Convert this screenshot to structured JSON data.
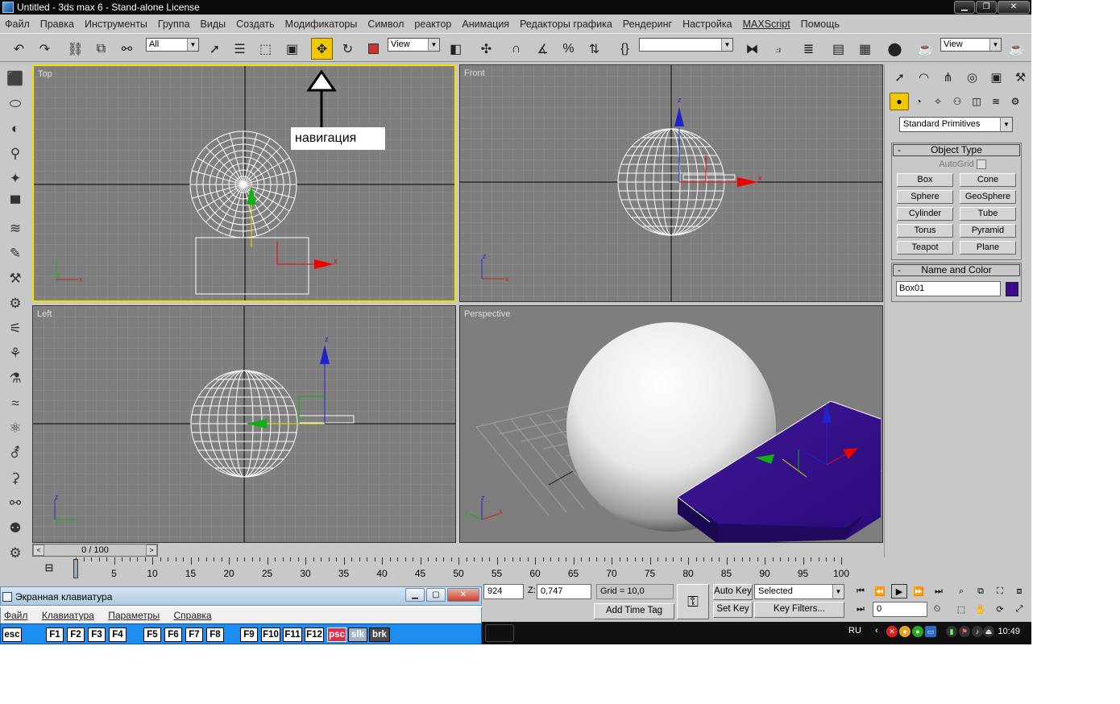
{
  "window": {
    "title": "Untitled - 3ds max 6 - Stand-alone License"
  },
  "menubar": [
    "Файл",
    "Правка",
    "Инструменты",
    "Группа",
    "Виды",
    "Создать",
    "Модификаторы",
    "Символ",
    "реактор",
    "Анимация",
    "Редакторы графика",
    "Рендеринг",
    "Настройка",
    "MAXScript",
    "Помощь"
  ],
  "toolbar": {
    "selection_filter": "All",
    "reference_coord": "View",
    "named_selection": "",
    "render_type": "View",
    "active_tool": "move-icon"
  },
  "viewports": {
    "top": {
      "label": "Top"
    },
    "front": {
      "label": "Front"
    },
    "left": {
      "label": "Left"
    },
    "perspective": {
      "label": "Perspective"
    }
  },
  "annotation": {
    "text": "навигация"
  },
  "axis_labels": {
    "x": "x",
    "y": "y",
    "z": "z"
  },
  "command_panel": {
    "category": "Standard Primitives",
    "object_type": {
      "title": "Object Type",
      "autogrid": "AutoGrid",
      "buttons": [
        "Box",
        "Cone",
        "Sphere",
        "GeoSphere",
        "Cylinder",
        "Tube",
        "Torus",
        "Pyramid",
        "Teapot",
        "Plane"
      ]
    },
    "name_and_color": {
      "title": "Name and Color",
      "name": "Box01",
      "color": "#3a0a90"
    }
  },
  "time_slider": {
    "position": "0 / 100",
    "current_frame": 0,
    "total_frames": 100
  },
  "trackbar": {
    "ticks": [
      "0",
      "5",
      "10",
      "15",
      "20",
      "25",
      "30",
      "35",
      "40",
      "45",
      "50",
      "55",
      "60",
      "65",
      "70",
      "75",
      "80",
      "85",
      "90",
      "95",
      "100"
    ]
  },
  "status": {
    "y_value": "924",
    "z_label": "Z:",
    "z_value": "0,747",
    "grid": "Grid = 10,0",
    "add_time_tag": "Add Time Tag",
    "auto_key": "Auto Key",
    "set_key": "Set Key",
    "selected": "Selected",
    "key_filters": "Key Filters...",
    "frame": "0"
  },
  "taskbar": {
    "lang": "RU",
    "time": "10:49"
  },
  "onscreen_keyboard": {
    "title": "Экранная клавиатура",
    "menu": [
      "Файл",
      "Клавиатура",
      "Параметры",
      "Справка"
    ],
    "keys": [
      "esc",
      "F1",
      "F2",
      "F3",
      "F4",
      "F5",
      "F6",
      "F7",
      "F8",
      "F9",
      "F10",
      "F11",
      "F12",
      "psc",
      "slk",
      "brk"
    ]
  }
}
